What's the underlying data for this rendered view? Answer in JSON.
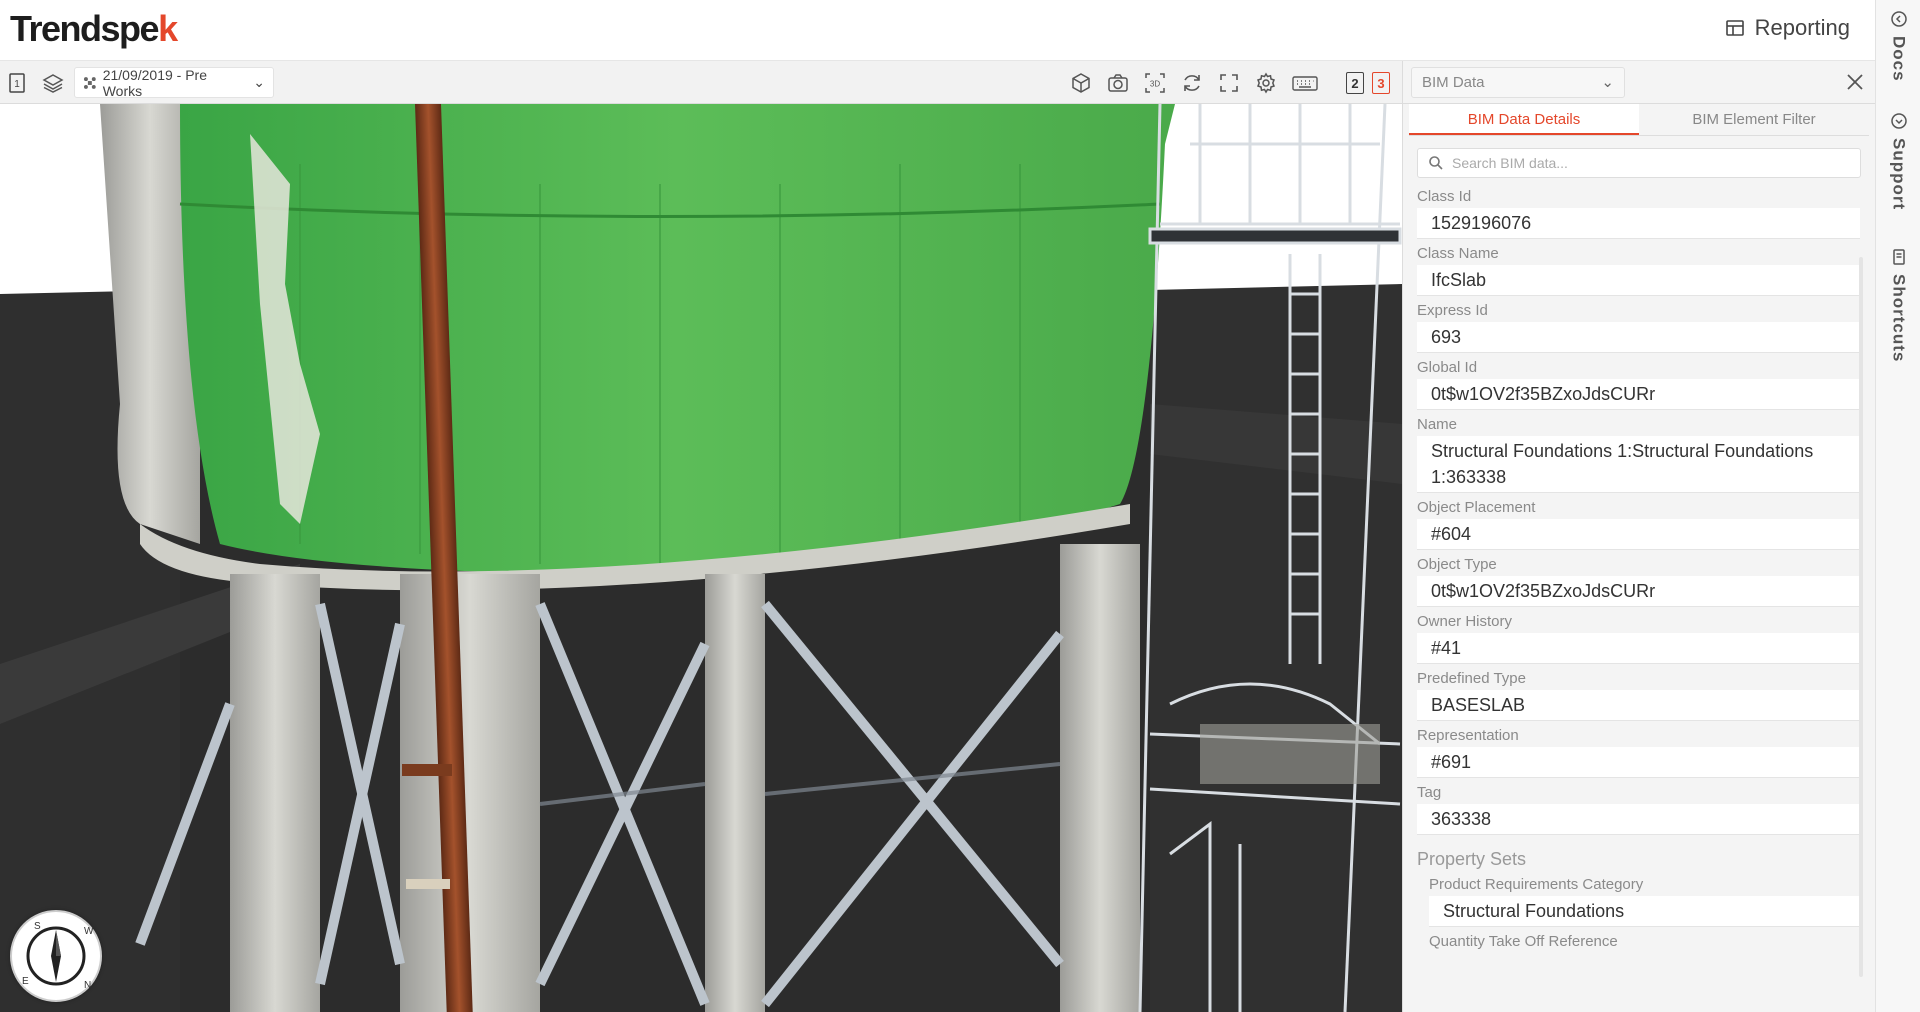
{
  "header": {
    "logo_main": "Trendspe",
    "logo_accent": "k",
    "reporting_label": "Reporting"
  },
  "toolbar": {
    "left_badge": "1",
    "date_select": "21/09/2019 - Pre Works",
    "layer_2": "2",
    "layer_3": "3"
  },
  "panel": {
    "select_placeholder": "BIM Data",
    "tabs": [
      "BIM Data Details",
      "BIM Element Filter"
    ],
    "search_placeholder": "Search BIM data...",
    "fields": [
      {
        "label": "Class Id",
        "value": "1529196076"
      },
      {
        "label": "Class Name",
        "value": "IfcSlab"
      },
      {
        "label": "Express Id",
        "value": "693"
      },
      {
        "label": "Global Id",
        "value": "0t$w1OV2f35BZxoJdsCURr"
      },
      {
        "label": "Name",
        "value": "Structural Foundations 1:Structural Foundations 1:363338"
      },
      {
        "label": "Object Placement",
        "value": "#604"
      },
      {
        "label": "Object Type",
        "value": "0t$w1OV2f35BZxoJdsCURr"
      },
      {
        "label": "Owner History",
        "value": "#41"
      },
      {
        "label": "Predefined Type",
        "value": "BASESLAB"
      },
      {
        "label": "Representation",
        "value": "#691"
      },
      {
        "label": "Tag",
        "value": "363338"
      }
    ],
    "property_sets_title": "Property Sets",
    "property_sets": [
      {
        "label": "Product Requirements Category",
        "value": "Structural Foundations"
      },
      {
        "label": "Quantity Take Off Reference",
        "value": ""
      }
    ]
  },
  "sidebar": {
    "docs": "Docs",
    "support": "Support",
    "shortcuts": "Shortcuts"
  },
  "colors": {
    "accent": "#e4472b",
    "bim_highlight": "#4caf50"
  },
  "compass": {
    "labels": [
      "S",
      "W",
      "N",
      "E"
    ]
  }
}
